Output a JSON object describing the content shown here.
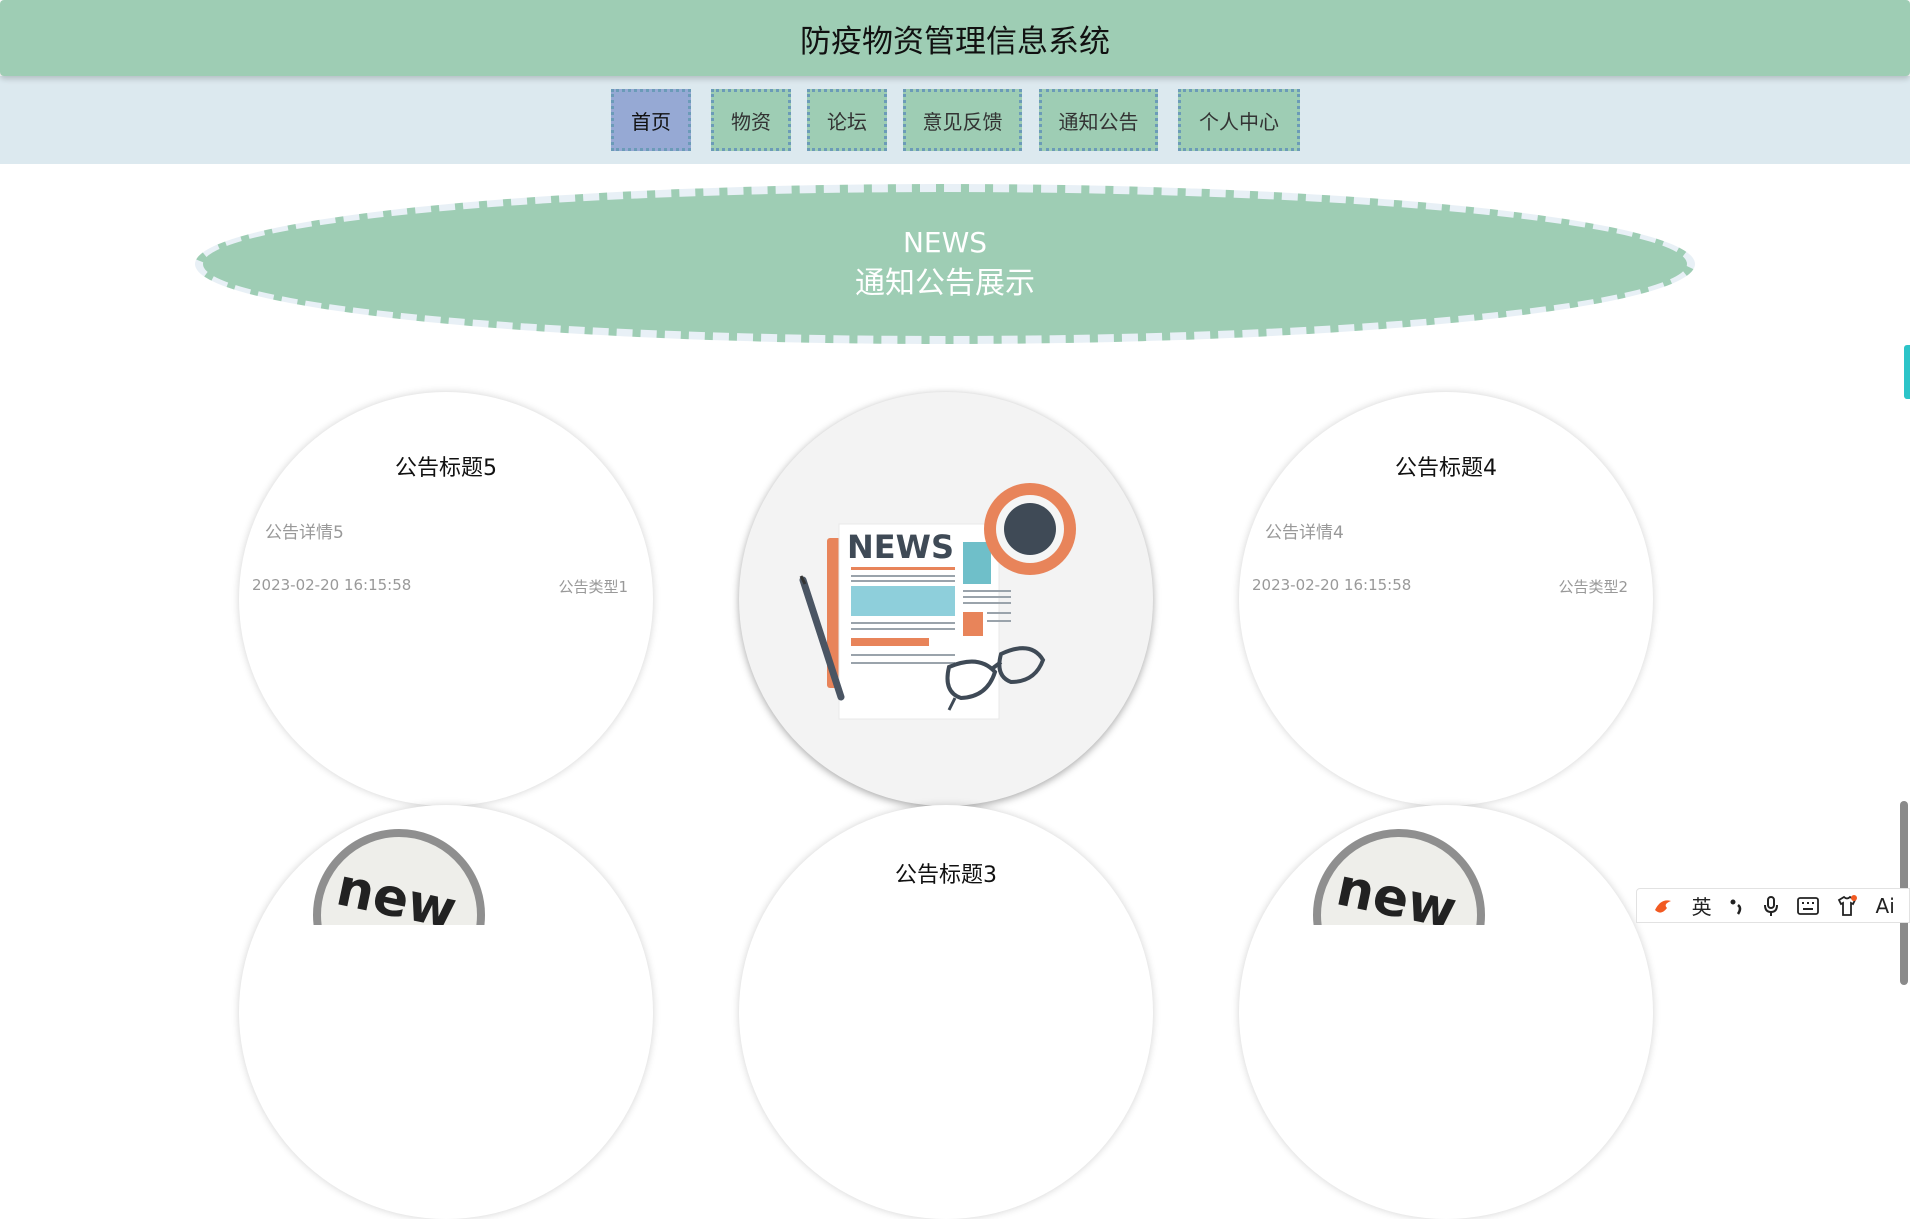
{
  "header": {
    "title": "防疫物资管理信息系统"
  },
  "nav": {
    "items": [
      {
        "label": "首页",
        "active": true
      },
      {
        "label": "物资",
        "active": false
      },
      {
        "label": "论坛",
        "active": false
      },
      {
        "label": "意见反馈",
        "active": false
      },
      {
        "label": "通知公告",
        "active": false
      },
      {
        "label": "个人中心",
        "active": false
      }
    ]
  },
  "banner": {
    "en": "NEWS",
    "cn": "通知公告展示"
  },
  "notices": [
    {
      "title": "公告标题5",
      "detail": "公告详情5",
      "date": "2023-02-20 16:15:58",
      "type": "公告类型1"
    },
    {
      "title": "公告标题4",
      "detail": "公告详情4",
      "date": "2023-02-20 16:15:58",
      "type": "公告类型2"
    },
    {
      "title": "公告标题3"
    }
  ],
  "images": {
    "news_word": "NEWS",
    "new_word": "new"
  },
  "ime": {
    "lang": "英",
    "ai": "Ai"
  },
  "colors": {
    "primary": "#9ecdb4",
    "nav_bg": "#dce9ef",
    "active": "#96a9d4"
  }
}
